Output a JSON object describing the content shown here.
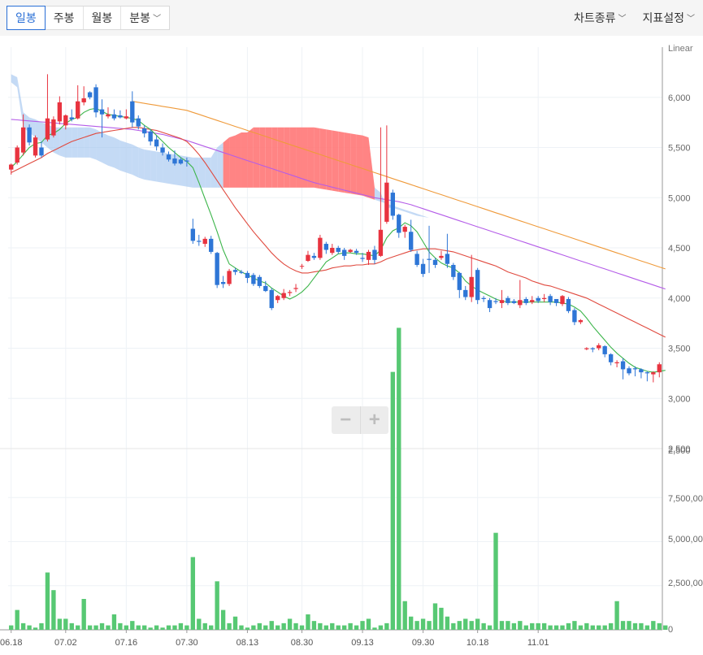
{
  "toolbar": {
    "tabs": [
      "일봉",
      "주봉",
      "월봉",
      "분봉"
    ],
    "active_tab": "일봉",
    "right_menu": [
      "차트종류",
      "지표설정"
    ]
  },
  "zoom": {
    "minus": "−",
    "plus": "+"
  },
  "colors": {
    "up": "#e8333f",
    "down": "#2e76d6",
    "volume": "#57c873",
    "ma5": "#3cb54a",
    "ma20": "#e04a3f",
    "ma60": "#b45ce8",
    "ma120": "#ef9a3a",
    "cloud_bull": "#ff7777",
    "cloud_bear": "#9cc1ef",
    "ichimoku_line": "#a9c9ef"
  },
  "chart_data": {
    "type": "candlestick",
    "scale_label": "Linear",
    "price_axis": {
      "ticks": [
        "6,000",
        "5,500",
        "5,000",
        "4,500",
        "4,000",
        "3,500",
        "3,000",
        "2,500"
      ],
      "range": [
        2500,
        6500
      ]
    },
    "volume_axis": {
      "ticks": [
        "2,500",
        "7,500,000",
        "5,000,000",
        "2,500,000",
        "0"
      ],
      "range": [
        0,
        10000000
      ]
    },
    "x_ticks": [
      "06.18",
      "07.02",
      "07.16",
      "07.30",
      "08.13",
      "08.30",
      "09.13",
      "09.30",
      "10.18",
      "11.01"
    ],
    "candles": [
      [
        5280,
        5330,
        5230,
        5340
      ],
      [
        5350,
        5500,
        5330,
        5520
      ],
      [
        5450,
        5700,
        5420,
        5830
      ],
      [
        5700,
        5550,
        5520,
        5730
      ],
      [
        5420,
        5600,
        5400,
        5620
      ],
      [
        5500,
        5420,
        5400,
        5560
      ],
      [
        5580,
        5790,
        5560,
        6230
      ],
      [
        5620,
        5780,
        5600,
        5810
      ],
      [
        5760,
        5950,
        5730,
        6010
      ],
      [
        5720,
        5820,
        5680,
        5830
      ],
      [
        5800,
        5780,
        5760,
        5880
      ],
      [
        5790,
        5960,
        5780,
        6120
      ],
      [
        5950,
        5990,
        5920,
        6110
      ],
      [
        6050,
        6000,
        5980,
        6060
      ],
      [
        6100,
        5850,
        5800,
        6130
      ],
      [
        5880,
        5830,
        5600,
        5980
      ],
      [
        5810,
        5830,
        5790,
        5900
      ],
      [
        5830,
        5790,
        5770,
        5880
      ],
      [
        5820,
        5800,
        5790,
        5870
      ],
      [
        5790,
        5810,
        5780,
        5880
      ],
      [
        5960,
        5750,
        5700,
        6060
      ],
      [
        5790,
        5710,
        5680,
        5820
      ],
      [
        5690,
        5640,
        5600,
        5720
      ],
      [
        5660,
        5560,
        5520,
        5680
      ],
      [
        5580,
        5510,
        5470,
        5620
      ],
      [
        5500,
        5450,
        5420,
        5540
      ],
      [
        5430,
        5380,
        5360,
        5460
      ],
      [
        5390,
        5340,
        5320,
        5470
      ],
      [
        5380,
        5340,
        5330,
        5400
      ],
      [
        5370,
        5360,
        5310,
        5400
      ],
      [
        4690,
        4570,
        4540,
        4790
      ],
      [
        4570,
        4560,
        4520,
        4630
      ],
      [
        4540,
        4590,
        4510,
        4610
      ],
      [
        4590,
        4460,
        4440,
        4620
      ],
      [
        4450,
        4130,
        4100,
        4460
      ],
      [
        4160,
        4140,
        4100,
        4220
      ],
      [
        4140,
        4270,
        4120,
        4290
      ],
      [
        4280,
        4260,
        4230,
        4300
      ],
      [
        4260,
        4250,
        4240,
        4280
      ],
      [
        4250,
        4200,
        4150,
        4270
      ],
      [
        4230,
        4140,
        4120,
        4250
      ],
      [
        4210,
        4120,
        4100,
        4230
      ],
      [
        4120,
        4070,
        4060,
        4170
      ],
      [
        4080,
        3900,
        3880,
        4100
      ],
      [
        3980,
        4020,
        3950,
        4030
      ],
      [
        4000,
        4050,
        3980,
        4090
      ],
      [
        4050,
        4060,
        4020,
        4080
      ],
      [
        4090,
        4100,
        4060,
        4140
      ],
      [
        4320,
        4320,
        4290,
        4340
      ],
      [
        4370,
        4430,
        4360,
        4470
      ],
      [
        4420,
        4400,
        4380,
        4450
      ],
      [
        4400,
        4600,
        4380,
        4630
      ],
      [
        4540,
        4480,
        4440,
        4560
      ],
      [
        4450,
        4500,
        4430,
        4540
      ],
      [
        4500,
        4460,
        4440,
        4520
      ],
      [
        4480,
        4420,
        4380,
        4500
      ],
      [
        4460,
        4480,
        4450,
        4490
      ],
      [
        4470,
        4450,
        4430,
        4490
      ],
      [
        4400,
        4390,
        4360,
        4450
      ],
      [
        4380,
        4460,
        4330,
        4480
      ],
      [
        4480,
        4380,
        4340,
        4520
      ],
      [
        4420,
        4680,
        4410,
        5700
      ],
      [
        4760,
        5150,
        4740,
        5720
      ],
      [
        5050,
        4820,
        4780,
        5080
      ],
      [
        4830,
        4650,
        4600,
        4840
      ],
      [
        4660,
        4710,
        4600,
        4730
      ],
      [
        4660,
        4480,
        4460,
        4780
      ],
      [
        4440,
        4330,
        4310,
        4470
      ],
      [
        4340,
        4240,
        4210,
        4390
      ],
      [
        4390,
        4380,
        4250,
        4720
      ],
      [
        4380,
        4330,
        4300,
        4400
      ],
      [
        4400,
        4420,
        4380,
        4470
      ],
      [
        4440,
        4340,
        4300,
        4640
      ],
      [
        4330,
        4210,
        4180,
        4350
      ],
      [
        4250,
        4080,
        4000,
        4260
      ],
      [
        4080,
        4010,
        3980,
        4120
      ],
      [
        4010,
        4210,
        3960,
        4430
      ],
      [
        4280,
        3980,
        3940,
        4300
      ],
      [
        4000,
        3990,
        3960,
        4020
      ],
      [
        3980,
        3900,
        3860,
        4000
      ],
      [
        3970,
        3960,
        3940,
        4000
      ],
      [
        3950,
        3980,
        3900,
        4080
      ],
      [
        4000,
        3950,
        3930,
        4020
      ],
      [
        3970,
        3950,
        3940,
        3990
      ],
      [
        3930,
        3980,
        3900,
        4180
      ],
      [
        3990,
        3950,
        3930,
        4010
      ],
      [
        3960,
        3980,
        3940,
        4020
      ],
      [
        4000,
        3970,
        3950,
        4020
      ],
      [
        3990,
        4000,
        3960,
        4040
      ],
      [
        4020,
        3960,
        3930,
        4040
      ],
      [
        3990,
        3950,
        3920,
        3980
      ],
      [
        3940,
        4020,
        3920,
        4030
      ],
      [
        3990,
        3870,
        3850,
        4010
      ],
      [
        3880,
        3760,
        3730,
        3900
      ],
      [
        3760,
        3780,
        3740,
        3790
      ],
      [
        3490,
        3500,
        3480,
        3510
      ],
      [
        3500,
        3490,
        3460,
        3510
      ],
      [
        3500,
        3530,
        3480,
        3550
      ],
      [
        3520,
        3440,
        3410,
        3530
      ],
      [
        3440,
        3360,
        3330,
        3450
      ],
      [
        3350,
        3360,
        3310,
        3380
      ],
      [
        3370,
        3290,
        3190,
        3400
      ],
      [
        3300,
        3250,
        3230,
        3320
      ],
      [
        3300,
        3290,
        3220,
        3320
      ],
      [
        3290,
        3260,
        3200,
        3300
      ],
      [
        3260,
        3250,
        3170,
        3270
      ],
      [
        3240,
        3260,
        3160,
        3270
      ],
      [
        3260,
        3340,
        3210,
        3360
      ]
    ],
    "volume": [
      0.2,
      0.9,
      0.3,
      0.2,
      0.1,
      0.3,
      2.6,
      1.8,
      0.5,
      0.5,
      0.3,
      0.2,
      1.4,
      0.2,
      0.2,
      0.3,
      0.2,
      0.7,
      0.3,
      0.2,
      0.4,
      0.2,
      0.2,
      0.1,
      0.2,
      0.1,
      0.2,
      0.2,
      0.3,
      0.2,
      3.3,
      0.5,
      0.3,
      0.2,
      2.2,
      0.9,
      0.3,
      0.6,
      0.2,
      0.1,
      0.2,
      0.3,
      0.2,
      0.4,
      0.2,
      0.3,
      0.5,
      0.3,
      0.2,
      0.7,
      0.4,
      0.3,
      0.2,
      0.3,
      0.2,
      0.2,
      0.3,
      0.2,
      0.4,
      0.5,
      0.1,
      0.2,
      0.3,
      11.7,
      13.7,
      1.3,
      0.6,
      0.4,
      0.5,
      0.4,
      1.2,
      1.0,
      0.6,
      0.3,
      0.4,
      0.5,
      0.4,
      0.5,
      0.3,
      0.2,
      4.4,
      0.4,
      0.4,
      0.3,
      0.4,
      0.2,
      0.3,
      0.3,
      0.3,
      0.2,
      0.2,
      0.2,
      0.3,
      0.4,
      0.2,
      0.3,
      0.2,
      0.2,
      0.2,
      0.3,
      1.3,
      0.4,
      0.4,
      0.3,
      0.3,
      0.2,
      0.4,
      0.3,
      0.2
    ],
    "ma": {
      "ma5": [
        5300,
        5360,
        5430,
        5500,
        5540,
        5550,
        5620,
        5640,
        5680,
        5740,
        5780,
        5800,
        5850,
        5880,
        5890,
        5860,
        5830,
        5820,
        5810,
        5800,
        5790,
        5770,
        5720,
        5680,
        5620,
        5560,
        5500,
        5450,
        5400,
        5360,
        5300,
        5150,
        4990,
        4830,
        4660,
        4480,
        4340,
        4300,
        4260,
        4230,
        4200,
        4170,
        4150,
        4100,
        4060,
        4020,
        3990,
        4020,
        4060,
        4120,
        4200,
        4280,
        4360,
        4400,
        4440,
        4450,
        4450,
        4440,
        4440,
        4430,
        4420,
        4480,
        4600,
        4670,
        4700,
        4750,
        4720,
        4660,
        4560,
        4460,
        4400,
        4350,
        4320,
        4300,
        4250,
        4170,
        4120,
        4080,
        4050,
        4020,
        3990,
        3970,
        3960,
        3960,
        3960,
        3960,
        3960,
        3960,
        3960,
        3960,
        3960,
        3950,
        3940,
        3910,
        3870,
        3800,
        3720,
        3650,
        3580,
        3510,
        3450,
        3400,
        3350,
        3310,
        3290,
        3270,
        3260,
        3270,
        3280
      ],
      "ma20": [
        5250,
        5280,
        5310,
        5340,
        5370,
        5400,
        5440,
        5470,
        5500,
        5530,
        5560,
        5580,
        5600,
        5620,
        5640,
        5650,
        5660,
        5670,
        5680,
        5690,
        5700,
        5700,
        5690,
        5680,
        5670,
        5650,
        5630,
        5610,
        5590,
        5560,
        5500,
        5430,
        5350,
        5260,
        5170,
        5080,
        4990,
        4900,
        4820,
        4740,
        4660,
        4590,
        4520,
        4450,
        4390,
        4340,
        4300,
        4270,
        4250,
        4250,
        4260,
        4270,
        4280,
        4300,
        4310,
        4320,
        4320,
        4330,
        4330,
        4340,
        4340,
        4360,
        4390,
        4410,
        4430,
        4450,
        4470,
        4480,
        4490,
        4490,
        4490,
        4480,
        4470,
        4460,
        4440,
        4420,
        4400,
        4380,
        4360,
        4340,
        4320,
        4290,
        4260,
        4240,
        4220,
        4200,
        4170,
        4150,
        4130,
        4120,
        4100,
        4080,
        4060,
        4040,
        4020,
        4000,
        3970,
        3940,
        3910,
        3880,
        3850,
        3820,
        3790,
        3760,
        3730,
        3700,
        3670,
        3640,
        3610
      ],
      "ma60": [
        5780,
        5775,
        5770,
        5765,
        5760,
        5755,
        5750,
        5745,
        5740,
        5735,
        5730,
        5725,
        5720,
        5715,
        5710,
        5705,
        5700,
        5695,
        5690,
        5685,
        5680,
        5670,
        5660,
        5650,
        5640,
        5630,
        5615,
        5600,
        5585,
        5570,
        5550,
        5530,
        5510,
        5490,
        5470,
        5450,
        5430,
        5410,
        5390,
        5370,
        5350,
        5330,
        5310,
        5290,
        5270,
        5250,
        5230,
        5210,
        5190,
        5170,
        5150,
        5135,
        5120,
        5105,
        5090,
        5075,
        5060,
        5045,
        5030,
        5015,
        5000,
        4990,
        4980,
        4970,
        4960,
        4945,
        4930,
        4910,
        4890,
        4870,
        4850,
        4830,
        4810,
        4790,
        4770,
        4750,
        4730,
        4710,
        4690,
        4670,
        4650,
        4630,
        4610,
        4590,
        4570,
        4550,
        4530,
        4510,
        4490,
        4470,
        4450,
        4430,
        4410,
        4390,
        4370,
        4350,
        4330,
        4310,
        4290,
        4270,
        4250,
        4230,
        4210,
        4190,
        4170,
        4150,
        4130,
        4110,
        4090
      ],
      "ma120": [
        null,
        null,
        null,
        null,
        null,
        null,
        null,
        null,
        null,
        null,
        null,
        null,
        null,
        null,
        null,
        null,
        null,
        null,
        null,
        null,
        5960,
        5950,
        5940,
        5930,
        5920,
        5910,
        5900,
        5890,
        5880,
        5870,
        5850,
        5830,
        5810,
        5790,
        5770,
        5750,
        5730,
        5710,
        5690,
        5670,
        5650,
        5630,
        5610,
        5590,
        5570,
        5550,
        5530,
        5510,
        5490,
        5470,
        5450,
        5430,
        5410,
        5390,
        5370,
        5350,
        5330,
        5310,
        5290,
        5270,
        5250,
        5230,
        5210,
        5190,
        5170,
        5150,
        5130,
        5110,
        5090,
        5070,
        5050,
        5030,
        5010,
        4990,
        4970,
        4950,
        4930,
        4910,
        4890,
        4870,
        4850,
        4830,
        4810,
        4790,
        4770,
        4750,
        4730,
        4710,
        4690,
        4670,
        4650,
        4630,
        4610,
        4590,
        4570,
        4550,
        4530,
        4510,
        4490,
        4470,
        4450,
        4430,
        4410,
        4390,
        4370,
        4350,
        4330,
        4310,
        4290
      ]
    },
    "ichimoku": {
      "span_a": [
        6230,
        6200,
        5850,
        5800,
        5780,
        5750,
        5730,
        5700,
        5700,
        5700,
        5700,
        5700,
        5700,
        5700,
        5680,
        5650,
        5620,
        5600,
        5570,
        5550,
        5530,
        5500,
        5480,
        5470,
        5460,
        5450,
        5440,
        5430,
        5420,
        5410,
        5400,
        5400,
        5400,
        5400,
        5500,
        5550,
        5600,
        5620,
        5650,
        5650,
        5700,
        5700,
        5700,
        5700,
        5700,
        5700,
        5700,
        5700,
        5700,
        5700,
        5700,
        5690,
        5680,
        5670,
        5660,
        5650,
        5640,
        5630,
        5620,
        5600,
        5100,
        5050,
        4900,
        4900,
        4880,
        4860,
        4840,
        4820,
        4810,
        4800,
        4780,
        4760,
        4740,
        4720,
        4700,
        4690,
        4680,
        4670,
        4660,
        4650,
        4640,
        4630,
        4620,
        4610,
        4600,
        4590,
        4580,
        4570,
        4560,
        4550,
        4540,
        4530,
        4520,
        4510,
        4500,
        4490,
        4480,
        4470,
        4460,
        4450,
        4440,
        4430,
        4420,
        4410,
        4400,
        4390,
        4380,
        4370,
        4360
      ],
      "span_b": [
        6150,
        6100,
        5700,
        5650,
        5600,
        5550,
        5500,
        5450,
        5420,
        5400,
        5400,
        5400,
        5400,
        5400,
        5380,
        5350,
        5320,
        5300,
        5270,
        5250,
        5230,
        5200,
        5180,
        5170,
        5160,
        5150,
        5140,
        5130,
        5120,
        5110,
        5100,
        5100,
        5100,
        5100,
        5100,
        5100,
        5100,
        5100,
        5100,
        5100,
        5100,
        5100,
        5100,
        5100,
        5100,
        5100,
        5100,
        5100,
        5100,
        5100,
        5100,
        5090,
        5080,
        5070,
        5060,
        5050,
        5040,
        5030,
        5020,
        5000,
        4980,
        4960,
        4940,
        4920,
        4900,
        4880,
        4860,
        4840,
        4820,
        4800,
        4780,
        4760,
        4740,
        4720,
        4700,
        4690,
        4680,
        4670,
        4660,
        4650,
        4640,
        4630,
        4620,
        4610,
        4600,
        4590,
        4580,
        4570,
        4560,
        4550,
        4540,
        4530,
        4520,
        4510,
        4500,
        4490,
        4480,
        4470,
        4460,
        4450,
        4440,
        4430,
        4420,
        4410,
        4400,
        4390,
        4380,
        4370,
        4360
      ]
    }
  }
}
